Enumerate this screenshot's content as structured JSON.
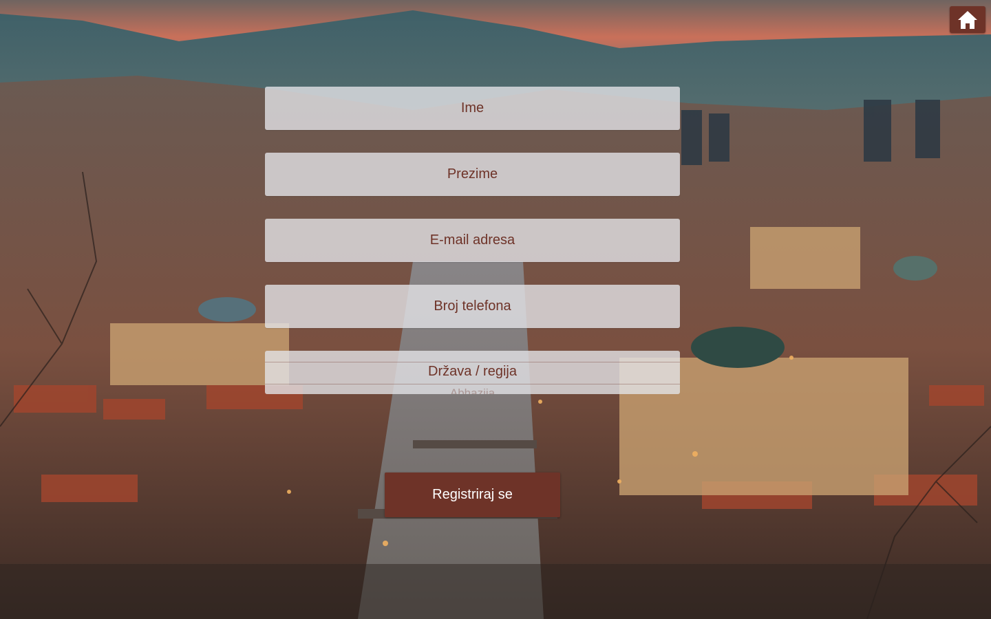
{
  "colors": {
    "accent": "#6e3328",
    "field_background": "#e2e2e6",
    "button_text": "#ffffff"
  },
  "header": {
    "home_icon": "home-icon"
  },
  "form": {
    "first_name_placeholder": "Ime",
    "last_name_placeholder": "Prezime",
    "email_placeholder": "E-mail adresa",
    "phone_placeholder": "Broj telefona",
    "country": {
      "selected": "Država / regija",
      "next_option": "Abhazija"
    },
    "submit_label": "Registriraj se"
  }
}
